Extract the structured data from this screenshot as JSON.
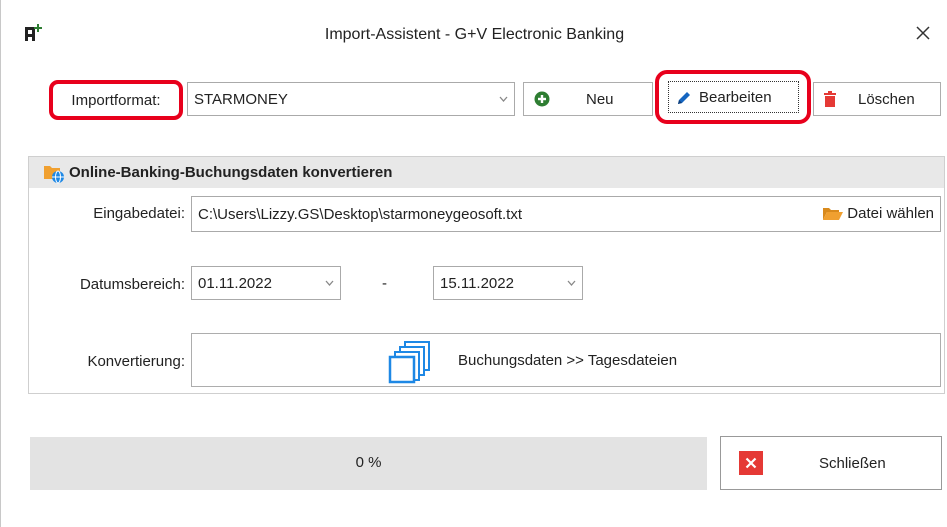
{
  "window": {
    "title": "Import-Assistent - G+V Electronic Banking"
  },
  "toolbar": {
    "format_label": "Importformat:",
    "format_value": "STARMONEY",
    "new_label": "Neu",
    "edit_label": "Bearbeiten",
    "delete_label": "Löschen"
  },
  "group": {
    "title": "Online-Banking-Buchungsdaten konvertieren",
    "input_label": "Eingabedatei:",
    "input_value": "C:\\Users\\Lizzy.GS\\Desktop\\starmoneygeosoft.txt",
    "choose_file_label": "Datei wählen",
    "date_label": "Datumsbereich:",
    "date_from": "01.11.2022",
    "date_separator": "-",
    "date_to": "15.11.2022",
    "conversion_label": "Konvertierung:",
    "conversion_button": "Buchungsdaten >> Tagesdateien"
  },
  "progress": {
    "value_percent": 0,
    "text": "0 %"
  },
  "footer": {
    "close_label": "Schließen"
  },
  "colors": {
    "highlight": "#e8001c",
    "add_green": "#2e7d32",
    "edit_blue": "#1565c0",
    "delete_red": "#e53935",
    "folder_orange": "#f0a030",
    "copy_blue": "#1e88e5"
  },
  "icons": {
    "app": "import-app-icon",
    "close": "close-icon",
    "new": "plus-circle-icon",
    "edit": "pencil-icon",
    "delete": "trash-icon",
    "group": "folder-globe-icon",
    "choose_file": "folder-open-icon",
    "conversion": "copy-pages-icon",
    "close_button": "x-box-icon"
  }
}
